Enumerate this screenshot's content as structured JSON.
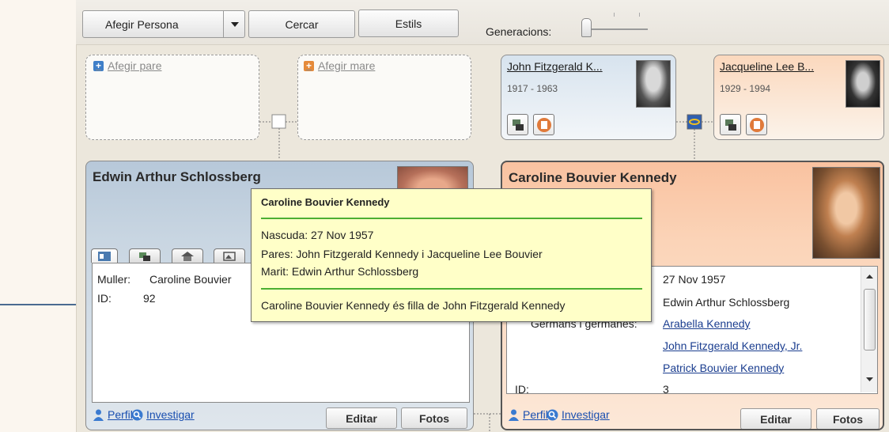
{
  "toolbar": {
    "add_person": "Afegir Persona",
    "search": "Cercar",
    "styles": "Estils",
    "generations_label": "Generacions:"
  },
  "empty_parents": {
    "add_father": "Afegir pare",
    "add_mother": "Afegir mare"
  },
  "parents": [
    {
      "name": "John Fitzgerald K...",
      "dates": "1917 - 1963"
    },
    {
      "name": "Jacqueline Lee B...",
      "dates": "1929 - 1994"
    }
  ],
  "spouse_card": {
    "name": "Edwin Arthur Schlossberg",
    "wife_label": "Muller:",
    "wife_value": "Caroline Bouvier",
    "id_label": "ID:",
    "id_value": "92",
    "profile": "Perfil",
    "research": "Investigar",
    "edit": "Editar",
    "photos": "Fotos"
  },
  "focus_card": {
    "name": "Caroline Bouvier Kennedy",
    "born_value": "27 Nov 1957",
    "spouse_value": "Edwin Arthur Schlossberg",
    "siblings_label": "Germans i germanes:",
    "siblings": [
      "Arabella Kennedy",
      "John Fitzgerald Kennedy, Jr.",
      "Patrick Bouvier Kennedy"
    ],
    "id_label": "ID:",
    "id_value": "3",
    "profile": "Perfil",
    "research": "Investigar",
    "edit": "Editar",
    "photos": "Fotos"
  },
  "tooltip": {
    "title": "Caroline Bouvier Kennedy",
    "born": "Nascuda: 27 Nov 1957",
    "parents": "Pares: John Fitzgerald Kennedy i Jacqueline Lee Bouvier",
    "husband": "Marit: Edwin Arthur Schlossberg",
    "relation": "Caroline Bouvier Kennedy és filla de John Fitzgerald Kennedy"
  },
  "colors": {
    "male_card": "#b8c8d8",
    "female_card": "#f8c8a8",
    "tooltip_bg": "#ffffc8",
    "tooltip_rule": "#4caf32",
    "link": "#1a3d8f"
  }
}
